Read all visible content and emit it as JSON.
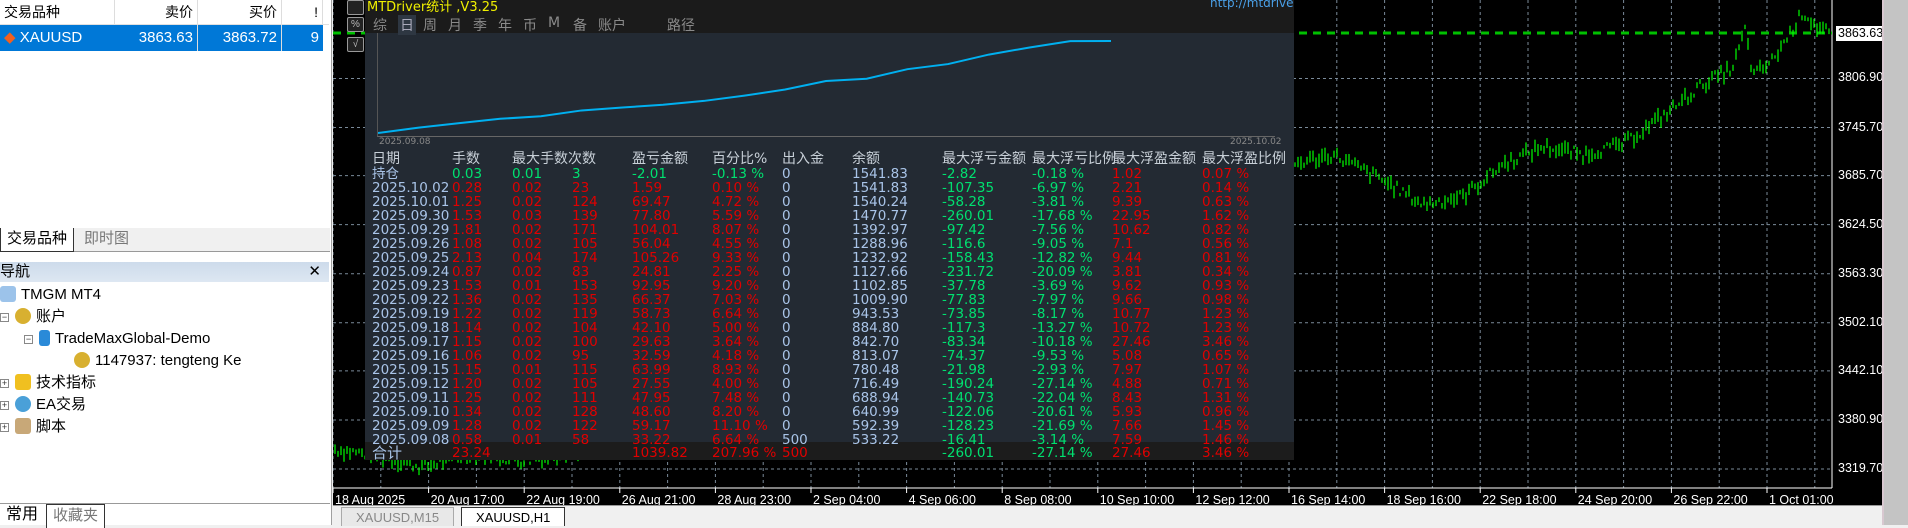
{
  "market_watch": {
    "headers": [
      "交易品种",
      "卖价",
      "买价",
      "!"
    ],
    "row": {
      "symbol": "XAUUSD",
      "bid": "3863.63",
      "ask": "3863.72",
      "spread": "9"
    },
    "tabs": [
      "交易品种",
      "即时图"
    ]
  },
  "navigator": {
    "title": "导航",
    "items": [
      {
        "label": "TMGM MT4"
      },
      {
        "label": "账户"
      },
      {
        "label": "TradeMaxGlobal-Demo"
      },
      {
        "label": "1147937: tengteng Ke"
      },
      {
        "label": "技术指标"
      },
      {
        "label": "EA交易"
      },
      {
        "label": "脚本"
      }
    ],
    "tabs": [
      "常用",
      "收藏夹"
    ]
  },
  "chart": {
    "symbol_tabs": [
      "XAUUSD,M15",
      "XAUUSD,H1"
    ],
    "current_price": "3863.63",
    "price_ticks": [
      "3806.90",
      "3745.70",
      "3685.70",
      "3624.50",
      "3563.30",
      "3502.10",
      "3442.10",
      "3380.90",
      "3319.70"
    ],
    "time_ticks": [
      "18 Aug 2025",
      "20 Aug 17:00",
      "22 Aug 19:00",
      "26 Aug 21:00",
      "28 Aug 23:00",
      "2 Sep 04:00",
      "4 Sep 06:00",
      "8 Sep 08:00",
      "10 Sep 10:00",
      "12 Sep 12:00",
      "16 Sep 14:00",
      "18 Sep 16:00",
      "22 Sep 18:00",
      "24 Sep 20:00",
      "26 Sep 22:00",
      "1 Oct 01:00"
    ],
    "bar_color": "#00ff00"
  },
  "stats": {
    "title": "MTDriver统计 ,V3.25",
    "url": "http://mtdriver.cn",
    "menu": [
      "综",
      "日",
      "周",
      "月",
      "季",
      "年",
      "币",
      "M",
      "备",
      "账户",
      "路径"
    ],
    "active_menu": "日",
    "mini_chart": {
      "start": "2025.09.08",
      "end": "2025.10.02",
      "line_color": "#00b0f0"
    },
    "headers": [
      "日期",
      "手数",
      "最大手数",
      "次数",
      "盈亏金额",
      "百分比%",
      "出入金",
      "余额",
      "最大浮亏金额",
      "最大浮亏比例",
      "最大浮盈金额",
      "最大浮盈比例"
    ],
    "rows": [
      [
        "持仓",
        "0.03",
        "0.01",
        "3",
        "-2.01",
        "-0.13 %",
        "0",
        "1541.83",
        "-2.82",
        "-0.18 %",
        "1.02",
        "0.07 %"
      ],
      [
        "2025.10.02",
        "0.28",
        "0.02",
        "23",
        "1.59",
        "0.10 %",
        "0",
        "1541.83",
        "-107.35",
        "-6.97 %",
        "2.21",
        "0.14 %"
      ],
      [
        "2025.10.01",
        "1.25",
        "0.02",
        "124",
        "69.47",
        "4.72 %",
        "0",
        "1540.24",
        "-58.28",
        "-3.81 %",
        "9.39",
        "0.63 %"
      ],
      [
        "2025.09.30",
        "1.53",
        "0.03",
        "139",
        "77.80",
        "5.59 %",
        "0",
        "1470.77",
        "-260.01",
        "-17.68 %",
        "22.95",
        "1.62 %"
      ],
      [
        "2025.09.29",
        "1.81",
        "0.02",
        "171",
        "104.01",
        "8.07 %",
        "0",
        "1392.97",
        "-97.42",
        "-7.56 %",
        "10.62",
        "0.82 %"
      ],
      [
        "2025.09.26",
        "1.08",
        "0.02",
        "105",
        "56.04",
        "4.55 %",
        "0",
        "1288.96",
        "-116.6",
        "-9.05 %",
        "7.1",
        "0.56 %"
      ],
      [
        "2025.09.25",
        "2.13",
        "0.04",
        "174",
        "105.26",
        "9.33 %",
        "0",
        "1232.92",
        "-158.43",
        "-12.82 %",
        "9.44",
        "0.81 %"
      ],
      [
        "2025.09.24",
        "0.87",
        "0.02",
        "83",
        "24.81",
        "2.25 %",
        "0",
        "1127.66",
        "-231.72",
        "-20.09 %",
        "3.81",
        "0.34 %"
      ],
      [
        "2025.09.23",
        "1.53",
        "0.01",
        "153",
        "92.95",
        "9.20 %",
        "0",
        "1102.85",
        "-37.78",
        "-3.69 %",
        "9.62",
        "0.93 %"
      ],
      [
        "2025.09.22",
        "1.36",
        "0.02",
        "135",
        "66.37",
        "7.03 %",
        "0",
        "1009.90",
        "-77.83",
        "-7.97 %",
        "9.66",
        "0.98 %"
      ],
      [
        "2025.09.19",
        "1.22",
        "0.02",
        "119",
        "58.73",
        "6.64 %",
        "0",
        "943.53",
        "-73.85",
        "-8.17 %",
        "10.77",
        "1.23 %"
      ],
      [
        "2025.09.18",
        "1.14",
        "0.02",
        "104",
        "42.10",
        "5.00 %",
        "0",
        "884.80",
        "-117.3",
        "-13.27 %",
        "10.72",
        "1.23 %"
      ],
      [
        "2025.09.17",
        "1.15",
        "0.02",
        "100",
        "29.63",
        "3.64 %",
        "0",
        "842.70",
        "-83.34",
        "-10.18 %",
        "27.46",
        "3.46 %"
      ],
      [
        "2025.09.16",
        "1.06",
        "0.02",
        "95",
        "32.59",
        "4.18 %",
        "0",
        "813.07",
        "-74.37",
        "-9.53 %",
        "5.08",
        "0.65 %"
      ],
      [
        "2025.09.15",
        "1.15",
        "0.01",
        "115",
        "63.99",
        "8.93 %",
        "0",
        "780.48",
        "-21.98",
        "-2.93 %",
        "7.97",
        "1.07 %"
      ],
      [
        "2025.09.12",
        "1.20",
        "0.02",
        "105",
        "27.55",
        "4.00 %",
        "0",
        "716.49",
        "-190.24",
        "-27.14 %",
        "4.88",
        "0.71 %"
      ],
      [
        "2025.09.11",
        "1.25",
        "0.02",
        "111",
        "47.95",
        "7.48 %",
        "0",
        "688.94",
        "-140.73",
        "-22.04 %",
        "8.43",
        "1.31 %"
      ],
      [
        "2025.09.10",
        "1.34",
        "0.02",
        "128",
        "48.60",
        "8.20 %",
        "0",
        "640.99",
        "-122.06",
        "-20.61 %",
        "5.93",
        "0.96 %"
      ],
      [
        "2025.09.09",
        "1.28",
        "0.02",
        "122",
        "59.17",
        "11.10 %",
        "0",
        "592.39",
        "-128.23",
        "-21.69 %",
        "7.66",
        "1.45 %"
      ],
      [
        "2025.09.08",
        "0.58",
        "0.01",
        "58",
        "33.22",
        "6.64 %",
        "500",
        "533.22",
        "-16.41",
        "-3.14 %",
        "7.59",
        "1.46 %"
      ]
    ],
    "total": [
      "合计",
      "23.24",
      "",
      "",
      "1039.82",
      "207.96 %",
      "500",
      "",
      "-260.01",
      "-27.14 %",
      "27.46",
      "3.46 %"
    ]
  }
}
